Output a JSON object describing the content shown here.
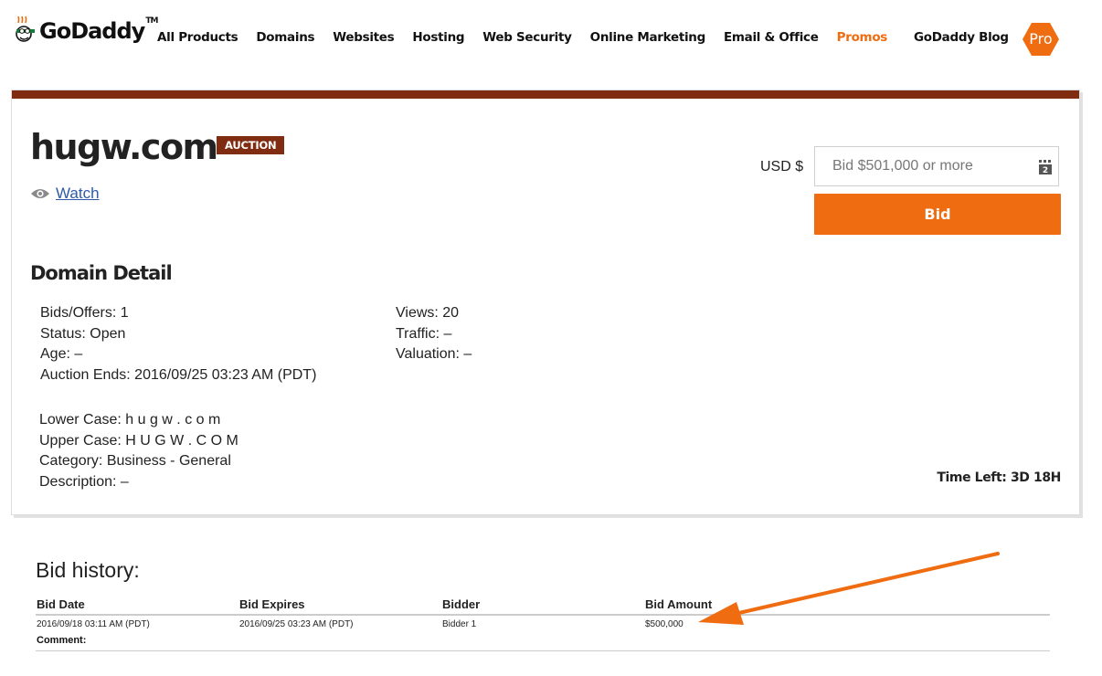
{
  "header": {
    "logo_text": "GoDaddy",
    "logo_tm": "TM",
    "nav": [
      "All Products",
      "Domains",
      "Websites",
      "Hosting",
      "Web Security",
      "Online Marketing",
      "Email & Office",
      "Promos"
    ],
    "blog": "GoDaddy Blog",
    "pro_badge": "Pro"
  },
  "domain": {
    "name": "hugw.com",
    "badge": "AUCTION",
    "watch_label": "Watch"
  },
  "bid_form": {
    "currency": "USD $",
    "placeholder": "Bid $501,000 or more",
    "calc_digit": "2",
    "button_label": "Bid"
  },
  "detail": {
    "title": "Domain Detail",
    "bids_offers": "Bids/Offers: 1",
    "status": "Status: Open",
    "age": "Age: –",
    "auction_ends": "Auction Ends: 2016/09/25 03:23 AM (PDT)",
    "views": "Views: 20",
    "traffic": "Traffic: –",
    "valuation": "Valuation: –",
    "lower_case": "Lower Case: h u g w . c o m",
    "upper_case": "Upper Case: H U G W . C O M",
    "category": "Category: Business - General",
    "description": "Description: –",
    "time_left": "Time Left: 3D 18H"
  },
  "bid_history": {
    "title": "Bid history:",
    "headers": [
      "Bid Date",
      "Bid Expires",
      "Bidder",
      "Bid Amount"
    ],
    "rows": [
      {
        "date": "2016/09/18 03:11 AM (PDT)",
        "expires": "2016/09/25 03:23 AM (PDT)",
        "bidder": "Bidder 1",
        "amount": "$500,000"
      }
    ],
    "comment_label": "Comment:"
  },
  "colors": {
    "brand_orange": "#ef6c10",
    "auction_brown": "#7f2c10",
    "link_blue": "#2d5ba8"
  }
}
